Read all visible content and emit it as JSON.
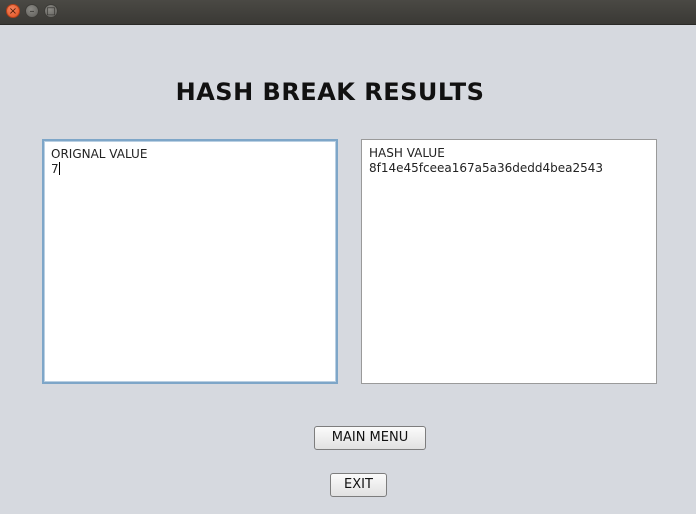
{
  "window": {
    "controls": {
      "close_icon": "×",
      "minimize_icon": "–",
      "maximize_icon": "□"
    }
  },
  "page": {
    "title": "HASH BREAK RESULTS"
  },
  "original": {
    "label": "ORIGNAL VALUE",
    "value": "7"
  },
  "hash": {
    "label": "HASH VALUE",
    "value": "8f14e45fceea167a5a36dedd4bea2543"
  },
  "buttons": {
    "main_menu": "MAIN MENU",
    "exit": "EXIT"
  }
}
